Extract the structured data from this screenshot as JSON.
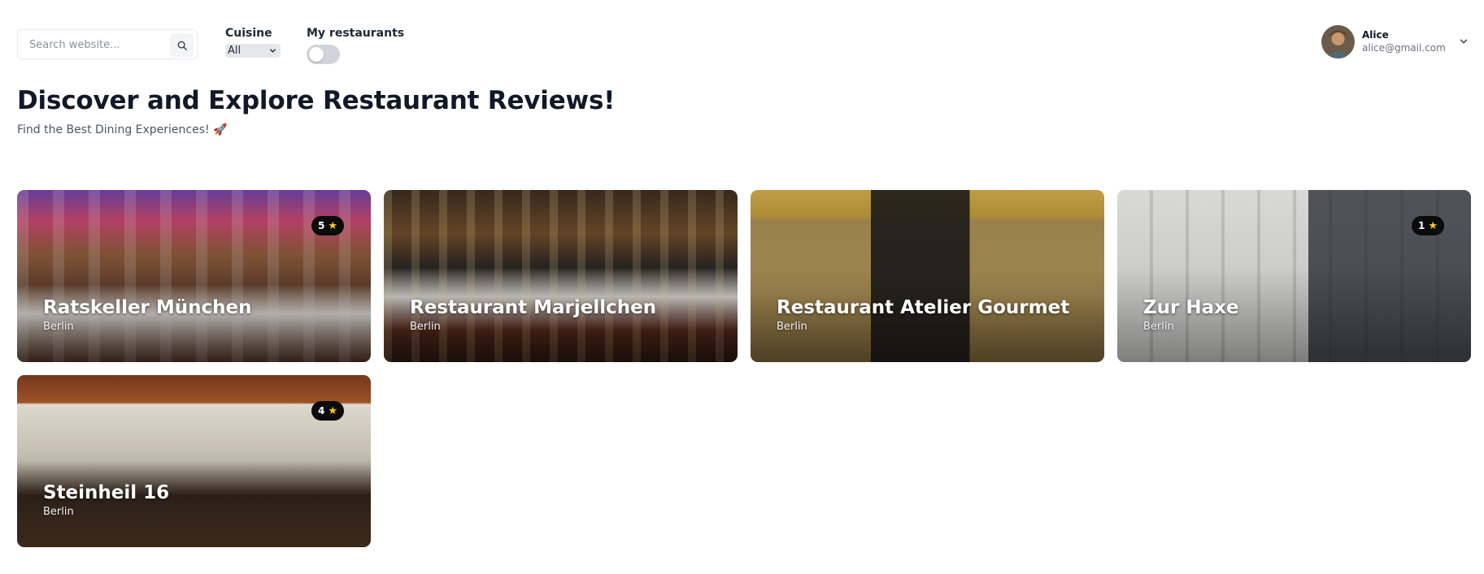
{
  "header": {
    "search": {
      "placeholder": "Search website..."
    },
    "cuisine": {
      "label": "Cuisine",
      "selected": "All"
    },
    "my_restaurants": {
      "label": "My restaurants",
      "enabled": false
    }
  },
  "user": {
    "name": "Alice",
    "email": "alice@gmail.com"
  },
  "hero": {
    "title": "Discover and Explore Restaurant Reviews!",
    "subtitle": "Find the Best Dining Experiences! 🚀"
  },
  "restaurants": [
    {
      "name": "Ratskeller München",
      "city": "Berlin",
      "rating": "5"
    },
    {
      "name": "Restaurant Marjellchen",
      "city": "Berlin",
      "rating": ""
    },
    {
      "name": "Restaurant Atelier Gourmet",
      "city": "Berlin",
      "rating": ""
    },
    {
      "name": "Zur Haxe",
      "city": "Berlin",
      "rating": "1"
    },
    {
      "name": "Steinheil 16",
      "city": "Berlin",
      "rating": "4"
    }
  ],
  "colors": {
    "text": "#111827",
    "star": "#facc15",
    "badge": "#0b0b0b"
  },
  "icons": {
    "search": "search-icon",
    "chevron": "chevron-down-icon",
    "star": "star-icon"
  }
}
